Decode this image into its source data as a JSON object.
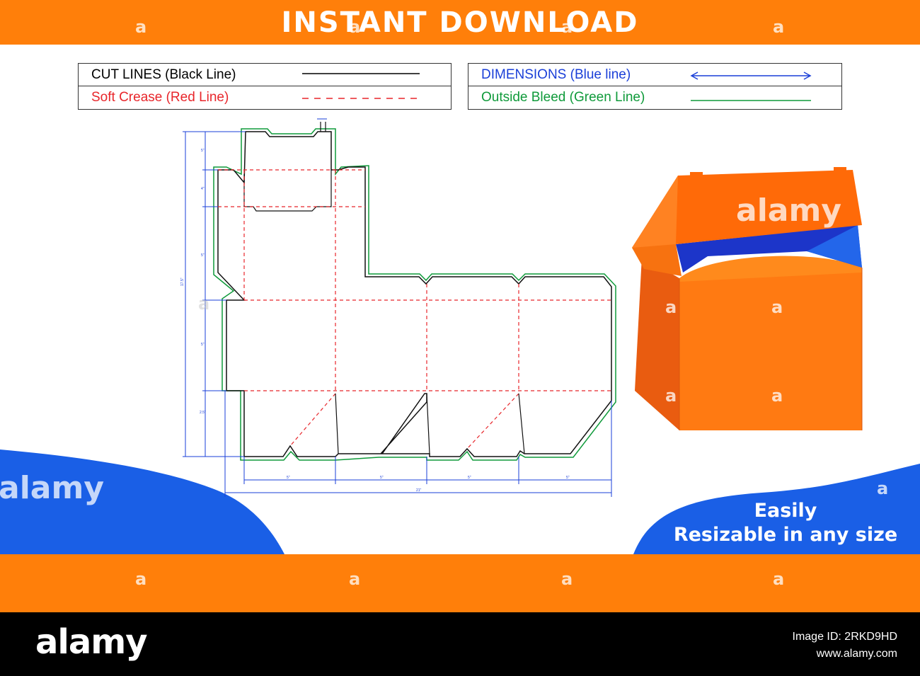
{
  "header": {
    "title": "INSTANT DOWNLOAD"
  },
  "legend_left": [
    {
      "label": "CUT LINES (Black Line)",
      "color": "#000000",
      "line_style": "solid"
    },
    {
      "label": "Soft Crease (Red Line)",
      "color": "#e8262b",
      "line_style": "dashed"
    }
  ],
  "legend_right": [
    {
      "label": "DIMENSIONS (Blue line)",
      "color": "#1a3fd8",
      "line_style": "double-arrow"
    },
    {
      "label": "Outside Bleed (Green Line)",
      "color": "#0f9a3a",
      "line_style": "solid"
    }
  ],
  "dieline": {
    "dimension_labels": {
      "height_total": "17.5\"",
      "width_total": "21\"",
      "panel_widths": [
        "5\"",
        "5\"",
        "5\"",
        "5\""
      ],
      "vertical_segments": [
        "5\"",
        "4\"",
        "5\"",
        "5\"",
        "2.5\""
      ]
    }
  },
  "tagline": {
    "line1": "Easily",
    "line2": "Resizable in any size"
  },
  "watermark": {
    "text": "alamy",
    "mark": "a"
  },
  "footer": {
    "brand": "alamy",
    "image_id": "Image ID: 2RKD9HD",
    "site": "www.alamy.com"
  },
  "colors": {
    "orange": "#ff7f0a",
    "blue": "#1a5fe6",
    "box_front": "#ff7a12",
    "box_side": "#e95c10",
    "box_inner": "#1c35c9"
  }
}
